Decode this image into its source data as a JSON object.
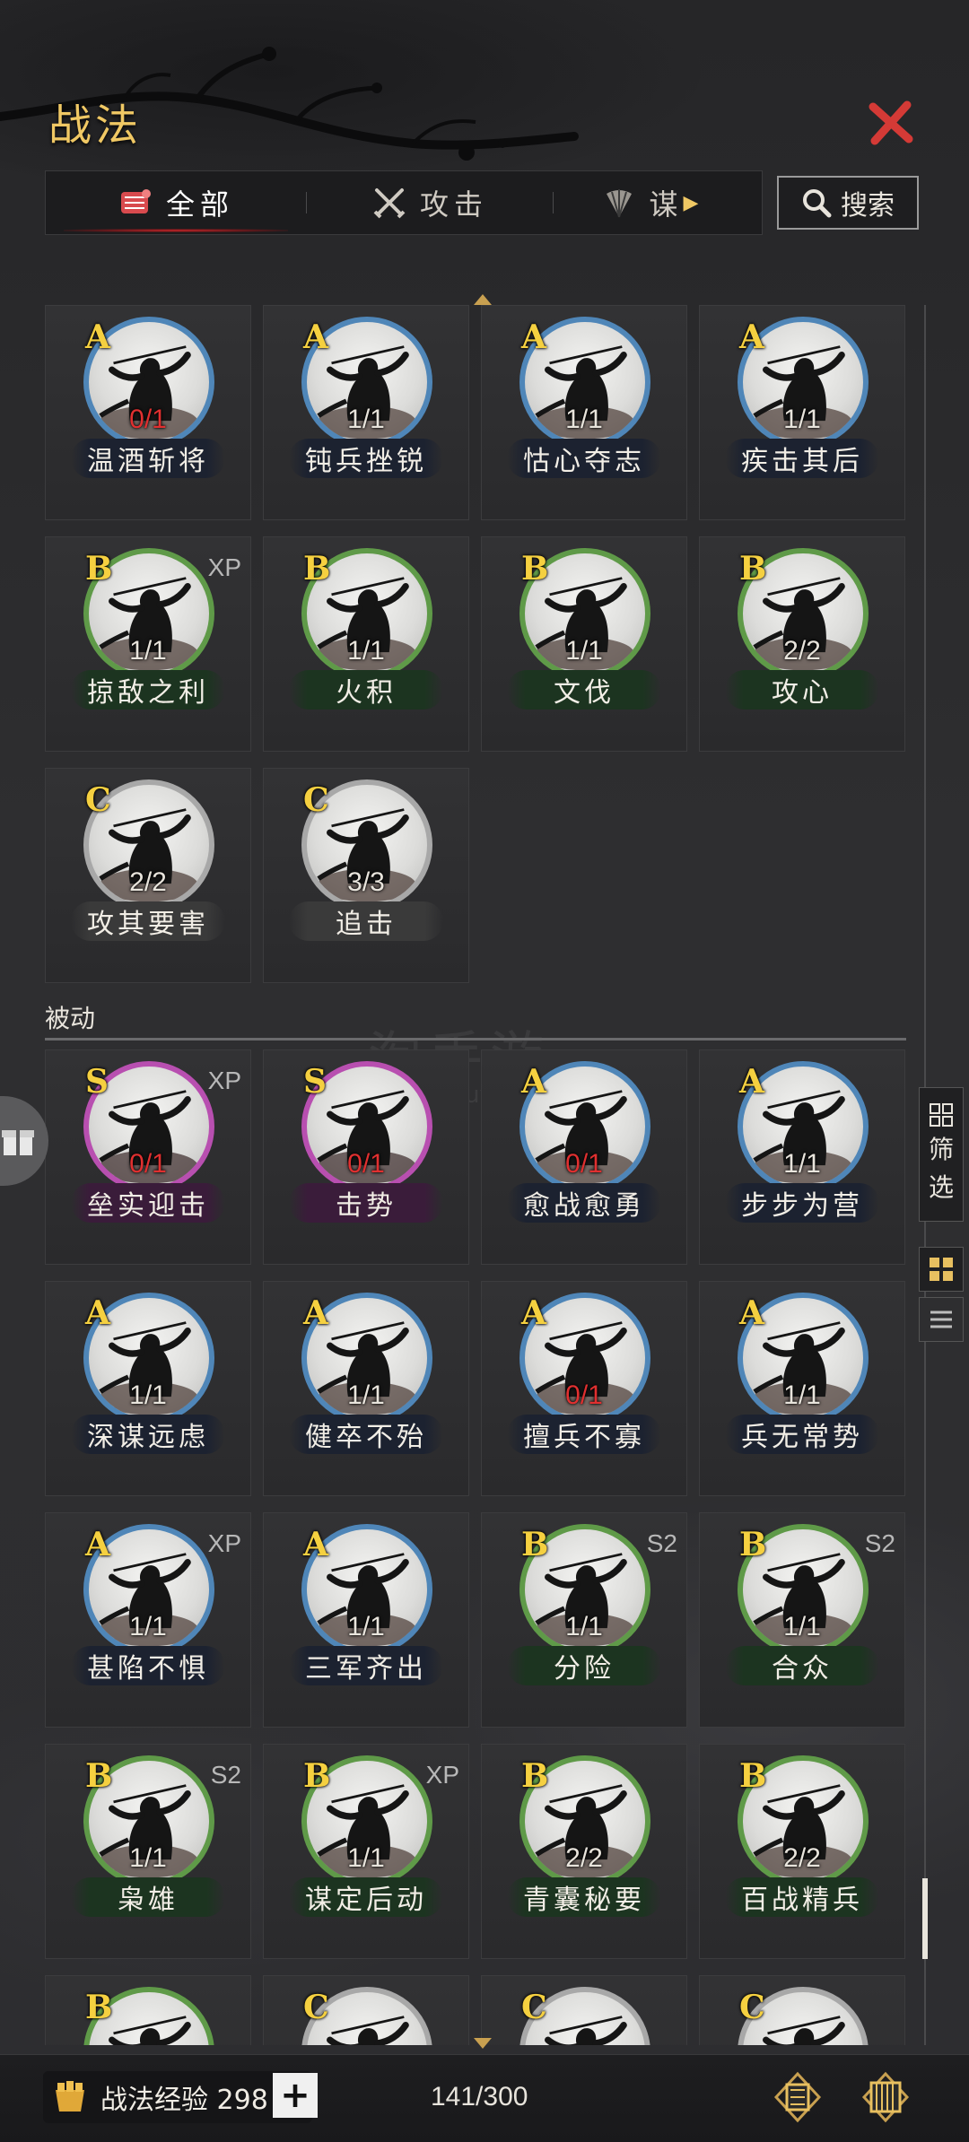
{
  "header": {
    "title": "战法"
  },
  "tabs": [
    {
      "label": "全部",
      "icon": "all-scrolls-icon",
      "active": true
    },
    {
      "label": "攻击",
      "icon": "crossed-swords-icon",
      "active": false
    },
    {
      "label": "谋",
      "icon": "feather-fan-icon",
      "active": false
    }
  ],
  "search": {
    "label": "搜索"
  },
  "active_section": {
    "cards": [
      {
        "grade": "A",
        "count": "0/1",
        "name": "温酒斩将",
        "tag": ""
      },
      {
        "grade": "A",
        "count": "1/1",
        "name": "钝兵挫锐",
        "tag": ""
      },
      {
        "grade": "A",
        "count": "1/1",
        "name": "怙心夺志",
        "tag": ""
      },
      {
        "grade": "A",
        "count": "1/1",
        "name": "疾击其后",
        "tag": ""
      },
      {
        "grade": "B",
        "count": "1/1",
        "name": "掠敌之利",
        "tag": "XP"
      },
      {
        "grade": "B",
        "count": "1/1",
        "name": "火积",
        "tag": ""
      },
      {
        "grade": "B",
        "count": "1/1",
        "name": "文伐",
        "tag": ""
      },
      {
        "grade": "B",
        "count": "2/2",
        "name": "攻心",
        "tag": ""
      },
      {
        "grade": "C",
        "count": "2/2",
        "name": "攻其要害",
        "tag": ""
      },
      {
        "grade": "C",
        "count": "3/3",
        "name": "追击",
        "tag": ""
      }
    ]
  },
  "passive_section": {
    "title": "被动",
    "cards": [
      {
        "grade": "S",
        "count": "0/1",
        "name": "垒实迎击",
        "tag": "XP"
      },
      {
        "grade": "S",
        "count": "0/1",
        "name": "击势",
        "tag": ""
      },
      {
        "grade": "A",
        "count": "0/1",
        "name": "愈战愈勇",
        "tag": ""
      },
      {
        "grade": "A",
        "count": "1/1",
        "name": "步步为营",
        "tag": ""
      },
      {
        "grade": "A",
        "count": "1/1",
        "name": "深谋远虑",
        "tag": ""
      },
      {
        "grade": "A",
        "count": "1/1",
        "name": "健卒不殆",
        "tag": ""
      },
      {
        "grade": "A",
        "count": "0/1",
        "name": "擅兵不寡",
        "tag": ""
      },
      {
        "grade": "A",
        "count": "1/1",
        "name": "兵无常势",
        "tag": ""
      },
      {
        "grade": "A",
        "count": "1/1",
        "name": "甚陷不惧",
        "tag": "XP"
      },
      {
        "grade": "A",
        "count": "1/1",
        "name": "三军齐出",
        "tag": ""
      },
      {
        "grade": "B",
        "count": "1/1",
        "name": "分险",
        "tag": "S2"
      },
      {
        "grade": "B",
        "count": "1/1",
        "name": "合众",
        "tag": "S2"
      },
      {
        "grade": "B",
        "count": "1/1",
        "name": "枭雄",
        "tag": "S2"
      },
      {
        "grade": "B",
        "count": "1/1",
        "name": "谋定后动",
        "tag": "XP"
      },
      {
        "grade": "B",
        "count": "2/2",
        "name": "青囊秘要",
        "tag": ""
      },
      {
        "grade": "B",
        "count": "2/2",
        "name": "百战精兵",
        "tag": ""
      },
      {
        "grade": "B",
        "count": "",
        "name": "",
        "tag": ""
      },
      {
        "grade": "C",
        "count": "",
        "name": "",
        "tag": ""
      },
      {
        "grade": "C",
        "count": "",
        "name": "",
        "tag": ""
      },
      {
        "grade": "C",
        "count": "",
        "name": "",
        "tag": ""
      }
    ]
  },
  "side": {
    "filter_label_1": "筛",
    "filter_label_2": "选"
  },
  "watermark": {
    "main": "淘手游",
    "sub": "taoshouyou.com"
  },
  "footer": {
    "exp_label": "战法经验 298",
    "plus": "+",
    "capacity": "141/300"
  },
  "colors": {
    "accent_gold": "#f0c864",
    "close_red": "#d43a36",
    "grade_S": "#b84fb0",
    "grade_A": "#4f86b8",
    "grade_B": "#5f9a48",
    "grade_C": "#a8a8a8"
  }
}
